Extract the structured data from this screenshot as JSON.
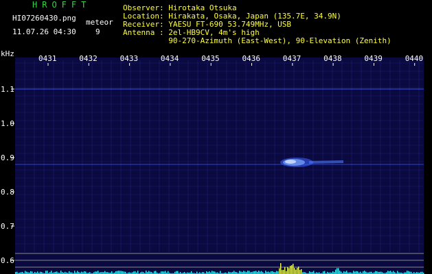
{
  "brand": "HROFFT",
  "file_name": "HI07260430.png",
  "meteor_label": "meteor",
  "datetime": "11.07.26 04:30",
  "meteor_count": "9",
  "info": [
    {
      "key": "Observer",
      "value": ": Hirotaka Otsuka"
    },
    {
      "key": "Location",
      "value": ": Hirakata, Osaka, Japan (135.7E, 34.9N)"
    },
    {
      "key": "Receiver",
      "value": ": YAESU FT-690 53.749MHz, USB"
    },
    {
      "key": "Antenna",
      "value": ": 2el-HB9CV, 4m's high"
    },
    {
      "key": "",
      "value": "  90-270-Azimuth (East-West), 90-Elevation (Zenith)"
    }
  ],
  "unit_label": "kHz",
  "time_ticks": [
    "0431",
    "0432",
    "0433",
    "0434",
    "0435",
    "0436",
    "0437",
    "0438",
    "0439",
    "0440"
  ],
  "freq_ticks": [
    "1.1",
    "1.0",
    "0.9",
    "0.8",
    "0.7",
    "0.6"
  ],
  "colors": {
    "background": "#000000",
    "plot_bg": "#0a0a40",
    "grid": "#1e1e7a",
    "signal": "#5a8cff",
    "echo": "#aac8ff",
    "brand": "#3cd24a",
    "header_text": "#ffffff",
    "info_text": "#ffff3c",
    "baseline": "#3cf0ff"
  }
}
